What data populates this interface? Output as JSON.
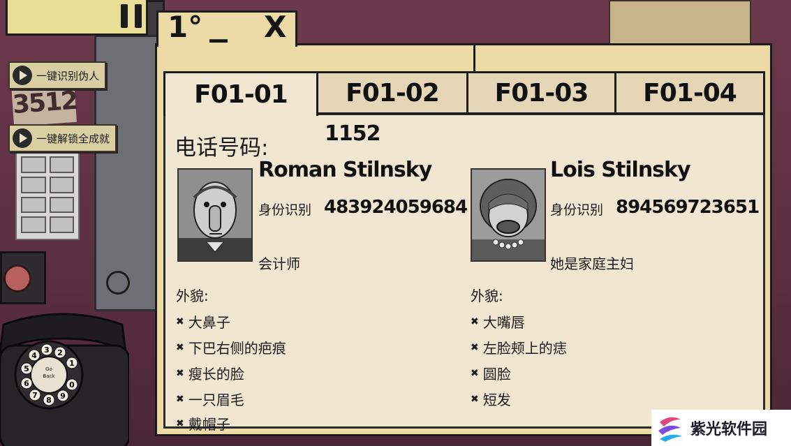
{
  "window": {
    "level_label": "1°",
    "minimize_glyph": "_",
    "close_glyph": "X"
  },
  "side_buttons": [
    {
      "label": "一键识别伪人"
    },
    {
      "label": "一键解锁全成就"
    }
  ],
  "background_note": "3512",
  "tabs": [
    {
      "label": "F01-01",
      "active": true
    },
    {
      "label": "F01-02",
      "active": false
    },
    {
      "label": "F01-03",
      "active": false
    },
    {
      "label": "F01-04",
      "active": false
    }
  ],
  "phone": {
    "label": "电话号码:",
    "value": "1152"
  },
  "persons": [
    {
      "name": "Roman Stilnsky",
      "id_label": "身份识别",
      "id_number": "483924059684",
      "job": "会计师",
      "appearance_label": "外貌:",
      "traits": [
        "大鼻子",
        "下巴右侧的疤痕",
        "瘦长的脸",
        "一只眉毛",
        "戴帽子"
      ]
    },
    {
      "name": "Lois Stilnsky",
      "id_label": "身份识别",
      "id_number": "894569723651",
      "job": "她是家庭主妇",
      "appearance_label": "外貌:",
      "traits": [
        "大嘴唇",
        "左脸颊上的痣",
        "圆脸",
        "短发"
      ]
    }
  ],
  "phone_dial": {
    "center_text": "Go Back",
    "digits": [
      "1",
      "2",
      "3",
      "4",
      "5",
      "6",
      "7",
      "8",
      "9",
      "0"
    ]
  },
  "watermark": {
    "text": "紫光软件园"
  },
  "colors": {
    "folder": "#ecdba7",
    "paper": "#f1e6d1",
    "ink": "#111111",
    "wall": "#5b2f40"
  }
}
